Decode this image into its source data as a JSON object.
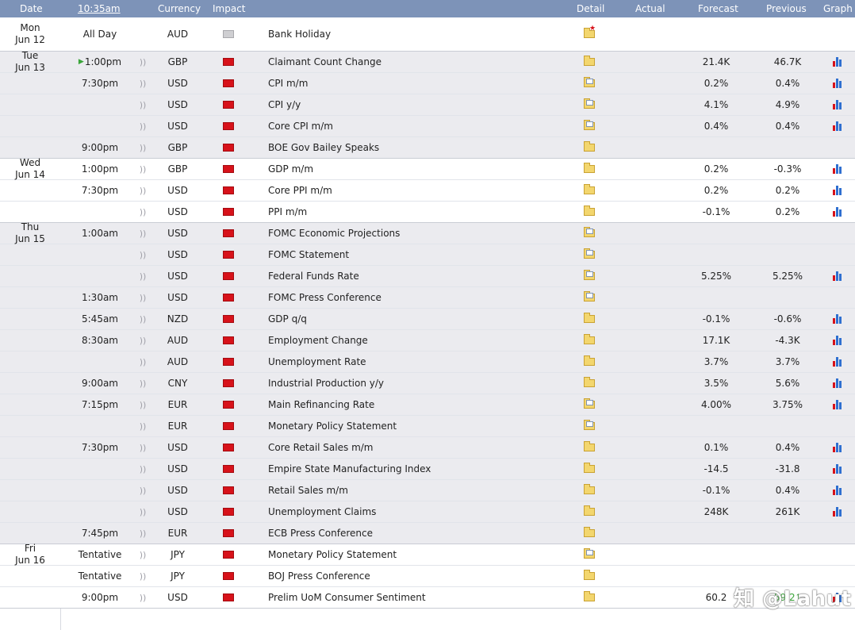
{
  "header": {
    "date": "Date",
    "time": "10:35am",
    "currency": "Currency",
    "impact": "Impact",
    "detail": "Detail",
    "actual": "Actual",
    "forecast": "Forecast",
    "previous": "Previous",
    "graph": "Graph"
  },
  "rows": [
    {
      "day": "Mon",
      "date": "Jun 12",
      "time": "All Day",
      "alert": false,
      "currency": "AUD",
      "impact": "gray",
      "event": "Bank Holiday",
      "detail": "star",
      "actual": "",
      "forecast": "",
      "previous": "",
      "graph": false
    },
    {
      "day": "Tue",
      "date": "Jun 13",
      "time": "1:00pm",
      "play": true,
      "alert": true,
      "currency": "GBP",
      "impact": "red",
      "event": "Claimant Count Change",
      "detail": "folder",
      "actual": "",
      "forecast": "21.4K",
      "previous": "46.7K",
      "graph": true
    },
    {
      "time": "7:30pm",
      "alert": true,
      "currency": "USD",
      "impact": "red",
      "event": "CPI m/m",
      "detail": "doc",
      "actual": "",
      "forecast": "0.2%",
      "previous": "0.4%",
      "graph": true
    },
    {
      "alert": true,
      "currency": "USD",
      "impact": "red",
      "event": "CPI y/y",
      "detail": "doc",
      "actual": "",
      "forecast": "4.1%",
      "previous": "4.9%",
      "graph": true
    },
    {
      "alert": true,
      "currency": "USD",
      "impact": "red",
      "event": "Core CPI m/m",
      "detail": "doc",
      "actual": "",
      "forecast": "0.4%",
      "previous": "0.4%",
      "graph": true
    },
    {
      "time": "9:00pm",
      "alert": true,
      "currency": "GBP",
      "impact": "red",
      "event": "BOE Gov Bailey Speaks",
      "detail": "folder",
      "actual": "",
      "forecast": "",
      "previous": "",
      "graph": false
    },
    {
      "day": "Wed",
      "date": "Jun 14",
      "time": "1:00pm",
      "alert": true,
      "currency": "GBP",
      "impact": "red",
      "event": "GDP m/m",
      "detail": "folder",
      "actual": "",
      "forecast": "0.2%",
      "previous": "-0.3%",
      "graph": true
    },
    {
      "time": "7:30pm",
      "alert": true,
      "currency": "USD",
      "impact": "red",
      "event": "Core PPI m/m",
      "detail": "folder",
      "actual": "",
      "forecast": "0.2%",
      "previous": "0.2%",
      "graph": true
    },
    {
      "alert": true,
      "currency": "USD",
      "impact": "red",
      "event": "PPI m/m",
      "detail": "folder",
      "actual": "",
      "forecast": "-0.1%",
      "previous": "0.2%",
      "graph": true
    },
    {
      "day": "Thu",
      "date": "Jun 15",
      "time": "1:00am",
      "alert": true,
      "currency": "USD",
      "impact": "red",
      "event": "FOMC Economic Projections",
      "detail": "doc",
      "actual": "",
      "forecast": "",
      "previous": "",
      "graph": false
    },
    {
      "alert": true,
      "currency": "USD",
      "impact": "red",
      "event": "FOMC Statement",
      "detail": "doc",
      "actual": "",
      "forecast": "",
      "previous": "",
      "graph": false
    },
    {
      "alert": true,
      "currency": "USD",
      "impact": "red",
      "event": "Federal Funds Rate",
      "detail": "doc",
      "actual": "",
      "forecast": "5.25%",
      "previous": "5.25%",
      "graph": true
    },
    {
      "time": "1:30am",
      "alert": true,
      "currency": "USD",
      "impact": "red",
      "event": "FOMC Press Conference",
      "detail": "doc",
      "actual": "",
      "forecast": "",
      "previous": "",
      "graph": false
    },
    {
      "time": "5:45am",
      "alert": true,
      "currency": "NZD",
      "impact": "red",
      "event": "GDP q/q",
      "detail": "folder",
      "actual": "",
      "forecast": "-0.1%",
      "previous": "-0.6%",
      "graph": true
    },
    {
      "time": "8:30am",
      "alert": true,
      "currency": "AUD",
      "impact": "red",
      "event": "Employment Change",
      "detail": "folder",
      "actual": "",
      "forecast": "17.1K",
      "previous": "-4.3K",
      "graph": true
    },
    {
      "alert": true,
      "currency": "AUD",
      "impact": "red",
      "event": "Unemployment Rate",
      "detail": "folder",
      "actual": "",
      "forecast": "3.7%",
      "previous": "3.7%",
      "graph": true
    },
    {
      "time": "9:00am",
      "alert": true,
      "currency": "CNY",
      "impact": "red",
      "event": "Industrial Production y/y",
      "detail": "folder",
      "actual": "",
      "forecast": "3.5%",
      "previous": "5.6%",
      "graph": true
    },
    {
      "time": "7:15pm",
      "alert": true,
      "currency": "EUR",
      "impact": "red",
      "event": "Main Refinancing Rate",
      "detail": "doc",
      "actual": "",
      "forecast": "4.00%",
      "previous": "3.75%",
      "graph": true
    },
    {
      "alert": true,
      "currency": "EUR",
      "impact": "red",
      "event": "Monetary Policy Statement",
      "detail": "doc",
      "actual": "",
      "forecast": "",
      "previous": "",
      "graph": false
    },
    {
      "time": "7:30pm",
      "alert": true,
      "currency": "USD",
      "impact": "red",
      "event": "Core Retail Sales m/m",
      "detail": "folder",
      "actual": "",
      "forecast": "0.1%",
      "previous": "0.4%",
      "graph": true
    },
    {
      "alert": true,
      "currency": "USD",
      "impact": "red",
      "event": "Empire State Manufacturing Index",
      "detail": "folder",
      "actual": "",
      "forecast": "-14.5",
      "previous": "-31.8",
      "graph": true
    },
    {
      "alert": true,
      "currency": "USD",
      "impact": "red",
      "event": "Retail Sales m/m",
      "detail": "folder",
      "actual": "",
      "forecast": "-0.1%",
      "previous": "0.4%",
      "graph": true
    },
    {
      "alert": true,
      "currency": "USD",
      "impact": "red",
      "event": "Unemployment Claims",
      "detail": "folder",
      "actual": "",
      "forecast": "248K",
      "previous": "261K",
      "graph": true
    },
    {
      "time": "7:45pm",
      "alert": true,
      "currency": "EUR",
      "impact": "red",
      "event": "ECB Press Conference",
      "detail": "folder",
      "actual": "",
      "forecast": "",
      "previous": "",
      "graph": false
    },
    {
      "day": "Fri",
      "date": "Jun 16",
      "time": "Tentative",
      "alert": true,
      "currency": "JPY",
      "impact": "red",
      "event": "Monetary Policy Statement",
      "detail": "doc",
      "actual": "",
      "forecast": "",
      "previous": "",
      "graph": false
    },
    {
      "time": "Tentative",
      "alert": true,
      "currency": "JPY",
      "impact": "red",
      "event": "BOJ Press Conference",
      "detail": "folder",
      "actual": "",
      "forecast": "",
      "previous": "",
      "graph": false
    },
    {
      "time": "9:00pm",
      "alert": true,
      "currency": "USD",
      "impact": "red",
      "event": "Prelim UoM Consumer Sentiment",
      "detail": "folder",
      "actual": "",
      "forecast": "60.2",
      "previous": "59.2",
      "previous_better": true,
      "graph": true
    }
  ],
  "day_groups": [
    {
      "start": 0,
      "count": 1,
      "shade": "w"
    },
    {
      "start": 1,
      "count": 5,
      "shade": "g"
    },
    {
      "start": 6,
      "count": 3,
      "shade": "w"
    },
    {
      "start": 9,
      "count": 15,
      "shade": "g"
    },
    {
      "start": 24,
      "count": 3,
      "shade": "w"
    }
  ],
  "watermark": "知 @Lahut"
}
